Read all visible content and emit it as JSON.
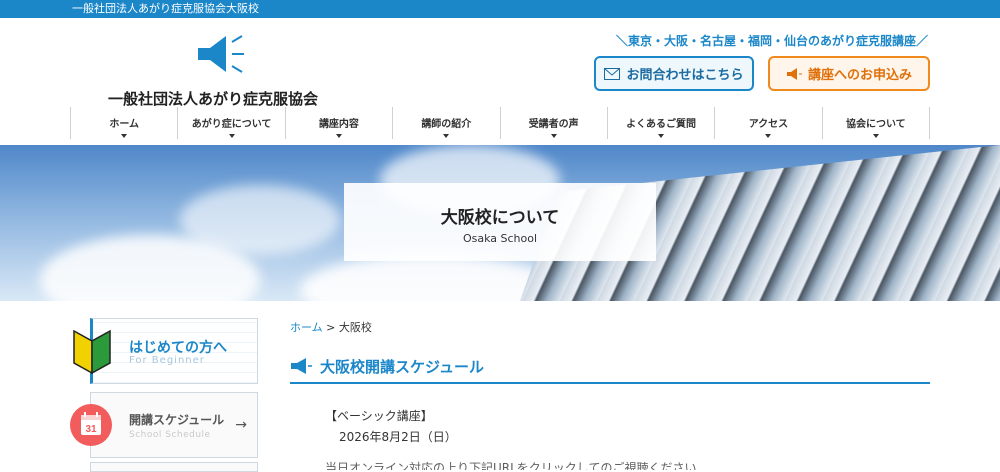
{
  "topbar": {
    "text": "一般社団法人あがり症克服協会大阪校"
  },
  "header": {
    "logo_name": "一般社団法人あがり症克服協会",
    "tagline": "＼東京・大阪・名古屋・福岡・仙台のあがり症克服講座／",
    "contact_label": "お問合わせはこちら",
    "apply_label": "講座へのお申込み"
  },
  "nav": {
    "items": [
      {
        "label": "ホーム"
      },
      {
        "label": "あがり症について"
      },
      {
        "label": "講座内容"
      },
      {
        "label": "講師の紹介"
      },
      {
        "label": "受講者の声"
      },
      {
        "label": "よくあるご質問"
      },
      {
        "label": "アクセス"
      },
      {
        "label": "協会について"
      }
    ]
  },
  "hero": {
    "title": "大阪校について",
    "subtitle": "Osaka School"
  },
  "sidebar": {
    "beginner_title": "はじめての方へ",
    "beginner_sub": "For Beginner",
    "schedule_title": "開講スケジュール",
    "schedule_sub": "School Schedule",
    "calendar_number": "31"
  },
  "breadcrumb": {
    "home": "ホーム",
    "separator": ">",
    "current": "大阪校"
  },
  "section": {
    "title": "大阪校開講スケジュール",
    "course": "【ベーシック講座】",
    "date": "2026年8月2日（日）",
    "cut_text": "当日オンライン対応の上り下記URLをクリックしてのご視聴ください"
  },
  "colors": {
    "brand_blue": "#1b87c9",
    "orange": "#f18a1c",
    "calendar_red": "#f25c5c"
  }
}
